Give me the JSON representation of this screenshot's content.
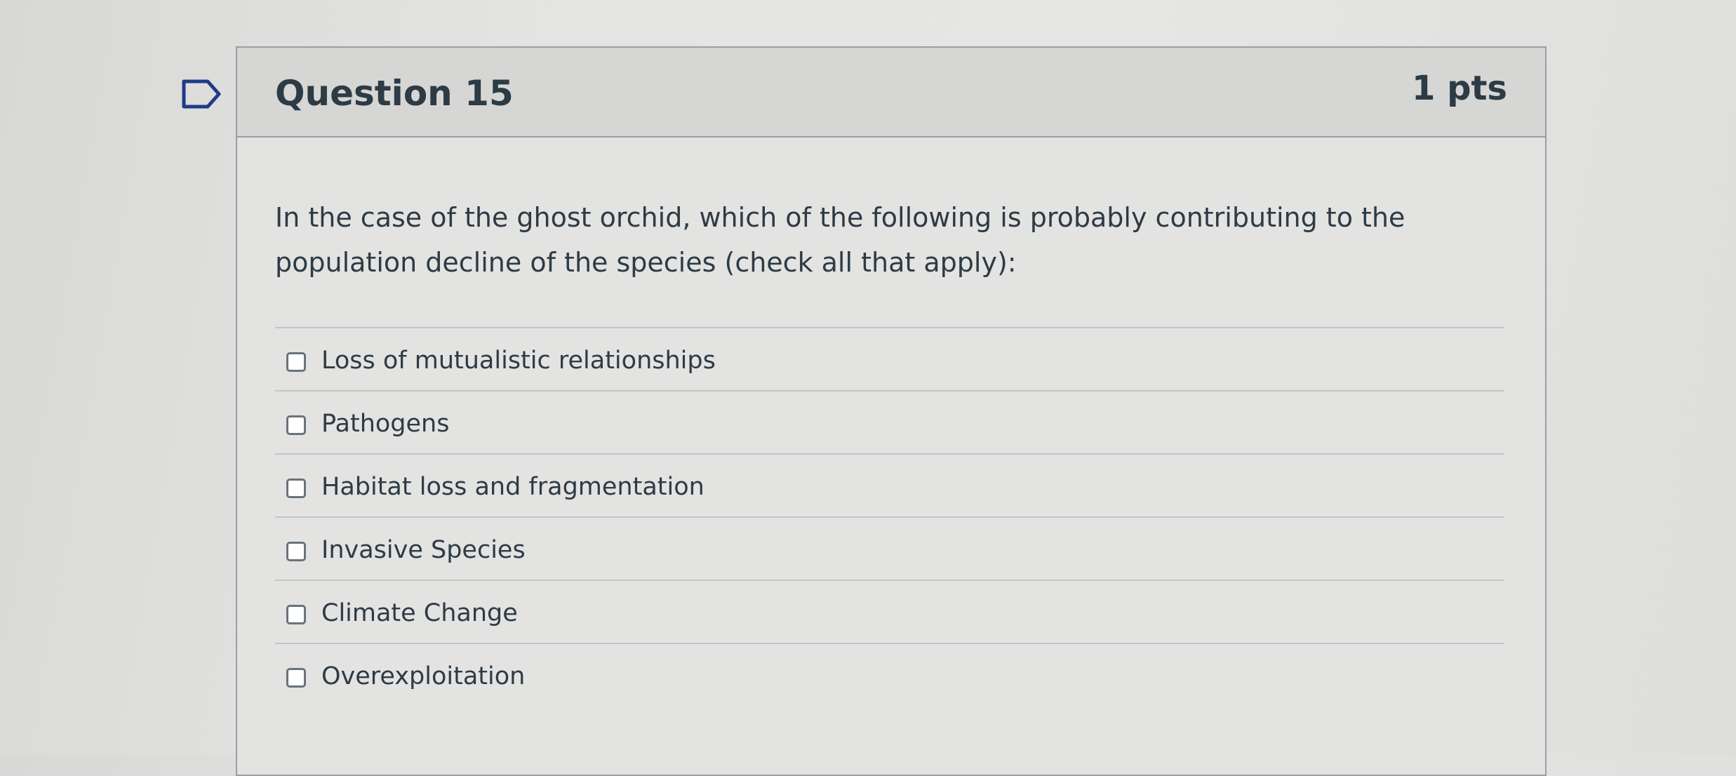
{
  "question": {
    "title": "Question 15",
    "points": "1 pts",
    "text": "In the case of the ghost orchid, which of the following is probably contributing to the population decline of the species (check all that apply):",
    "flag_icon": "flag-outline-icon"
  },
  "answers": [
    {
      "label": "Loss of mutualistic relationships",
      "checked": false
    },
    {
      "label": "Pathogens",
      "checked": false
    },
    {
      "label": "Habitat loss and fragmentation",
      "checked": false
    },
    {
      "label": "Invasive Species",
      "checked": false
    },
    {
      "label": "Climate Change",
      "checked": false
    },
    {
      "label": "Overexploitation",
      "checked": false
    }
  ]
}
